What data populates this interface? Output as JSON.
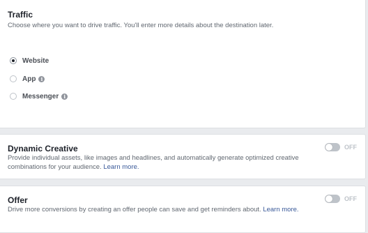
{
  "traffic": {
    "title": "Traffic",
    "description": "Choose where you want to drive traffic. You'll enter more details about the destination later.",
    "options": [
      {
        "label": "Website",
        "selected": true,
        "info_icon": false
      },
      {
        "label": "App",
        "selected": false,
        "info_icon": true
      },
      {
        "label": "Messenger",
        "selected": false,
        "info_icon": true
      }
    ]
  },
  "dynamic_creative": {
    "title": "Dynamic Creative",
    "description": "Provide individual assets, like images and headlines, and automatically generate optimized creative combinations for your audience.",
    "link": "Learn more.",
    "toggle_state": "OFF"
  },
  "offer": {
    "title": "Offer",
    "description": "Drive more conversions by creating an offer people can save and get reminders about.",
    "link": "Learn more.",
    "toggle_state": "OFF"
  },
  "icons": {
    "info": "info-icon",
    "toggle": "toggle-switch"
  },
  "colors": {
    "link": "#385898",
    "background": "#e9ebee",
    "toggle_off": "#bec3c9"
  }
}
